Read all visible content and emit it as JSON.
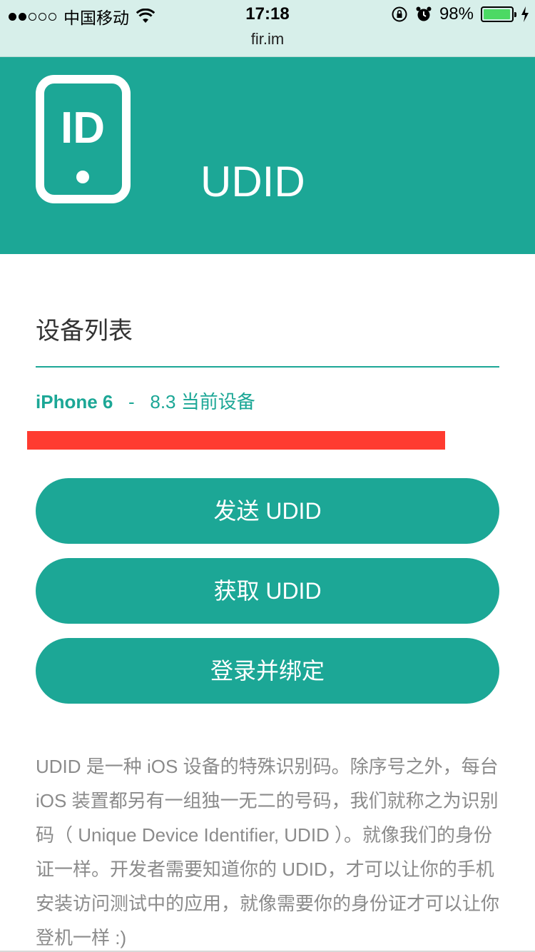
{
  "status_bar": {
    "carrier": "中国移动",
    "time": "17:18",
    "battery": "98%",
    "battery_level": 0.98,
    "signal_bars_filled": 2,
    "signal_bars_total": 5
  },
  "browser": {
    "url": "fir.im"
  },
  "header": {
    "logo_text": "ID",
    "title": "UDID",
    "background_color": "#1ca796"
  },
  "main": {
    "section_title": "设备列表",
    "device": {
      "model": "iPhone 6",
      "separator": "-",
      "version": "8.3 当前设备"
    },
    "buttons": [
      {
        "label": "发送 UDID"
      },
      {
        "label": "获取 UDID"
      },
      {
        "label": "登录并绑定"
      }
    ],
    "description": "UDID 是一种 iOS 设备的特殊识别码。除序号之外，每台 iOS 装置都另有一组独一无二的号码，我们就称之为识别码（ Unique Device Identifier, UDID ）。就像我们的身份证一样。开发者需要知道你的 UDID，才可以让你的手机安装访问测试中的应用，就像需要你的身份证才可以让你登机一样 :)"
  },
  "colors": {
    "accent": "#1ca796",
    "redaction": "#ff3b30",
    "status_bar_bg": "#d7efea",
    "battery_fill": "#4cd964"
  }
}
